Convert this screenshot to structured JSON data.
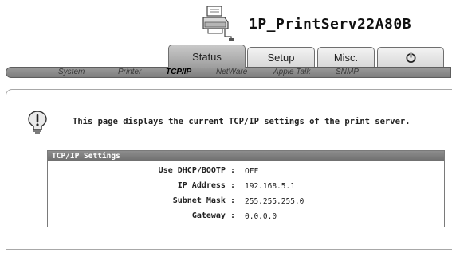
{
  "header": {
    "device_name": "1P_PrintServ22A80B",
    "printer_icon": "printer-icon"
  },
  "tabs": [
    {
      "label": "Status",
      "active": true
    },
    {
      "label": "Setup",
      "active": false
    },
    {
      "label": "Misc.",
      "active": false
    },
    {
      "label": "",
      "icon": "power-icon",
      "active": false
    }
  ],
  "subnav": [
    {
      "label": "System",
      "active": false
    },
    {
      "label": "Printer",
      "active": false
    },
    {
      "label": "TCP/IP",
      "active": true
    },
    {
      "label": "NetWare",
      "active": false
    },
    {
      "label": "Apple Talk",
      "active": false
    },
    {
      "label": "SNMP",
      "active": false
    }
  ],
  "info": {
    "icon": "lightbulb-info-icon",
    "text": "This page displays the current TCP/IP settings of the print server."
  },
  "settings": {
    "title": "TCP/IP Settings",
    "rows": [
      {
        "label": "Use DHCP/BOOTP :",
        "value": "OFF"
      },
      {
        "label": "IP Address :",
        "value": "192.168.5.1"
      },
      {
        "label": "Subnet Mask :",
        "value": "255.255.255.0"
      },
      {
        "label": "Gateway :",
        "value": "0.0.0.0"
      }
    ]
  },
  "colors": {
    "tab_active": "#a8a8a8",
    "tab_inactive": "#e6e6e6",
    "subnav_bar": "#8a8a8a",
    "settings_header": "#7a7a7a"
  }
}
